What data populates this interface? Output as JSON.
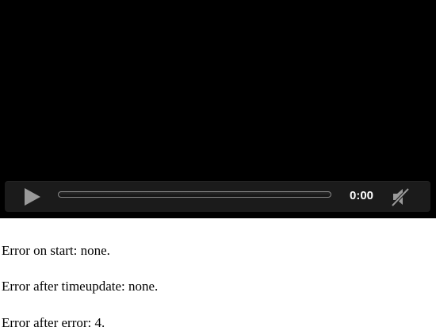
{
  "player": {
    "time_display": "0:00",
    "progress_fraction": 0,
    "play_icon": "play-icon",
    "mute_icon": "muted-speaker-icon",
    "colors": {
      "video_bg": "#000000",
      "control_bar_bg": "#1b1b1b",
      "icon_gray": "#9a9a9a",
      "time_text": "#ffffff"
    }
  },
  "status": {
    "start": "Error on start: none.",
    "timeupdate": "Error after timeupdate: none.",
    "error": "Error after error: 4."
  }
}
